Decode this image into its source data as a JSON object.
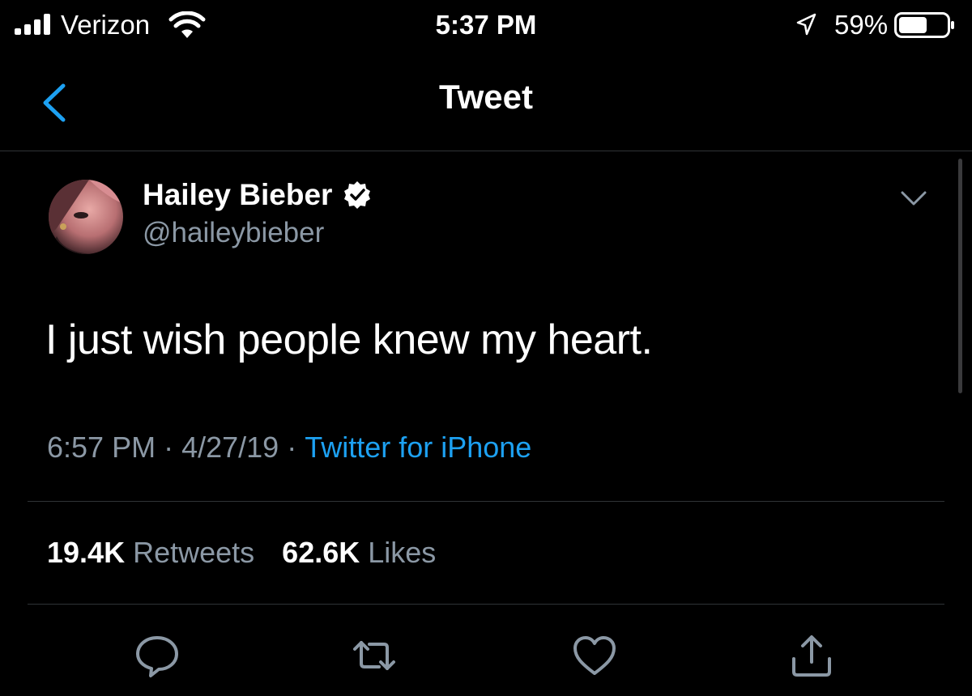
{
  "status_bar": {
    "carrier": "Verizon",
    "time": "5:37 PM",
    "battery_percent": "59%",
    "battery_level": 0.59,
    "signal_bars": 4
  },
  "nav": {
    "title": "Tweet",
    "back_icon": "chevron-left-icon"
  },
  "tweet": {
    "author_name": "Hailey Bieber",
    "author_handle": "@haileybieber",
    "verified": true,
    "text": "I just wish people knew my heart.",
    "time": "6:57 PM",
    "date": "4/27/19",
    "separator": "·",
    "source": "Twitter for iPhone"
  },
  "stats": {
    "retweets_count": "19.4K",
    "retweets_label": "Retweets",
    "likes_count": "62.6K",
    "likes_label": "Likes"
  },
  "actions": [
    "reply-icon",
    "retweet-icon",
    "like-icon",
    "share-icon"
  ],
  "colors": {
    "background": "#000000",
    "text_primary": "#ffffff",
    "text_secondary": "#8b98a5",
    "accent": "#1da1f2",
    "divider": "#2f3336",
    "icon": "#8b98a5"
  }
}
